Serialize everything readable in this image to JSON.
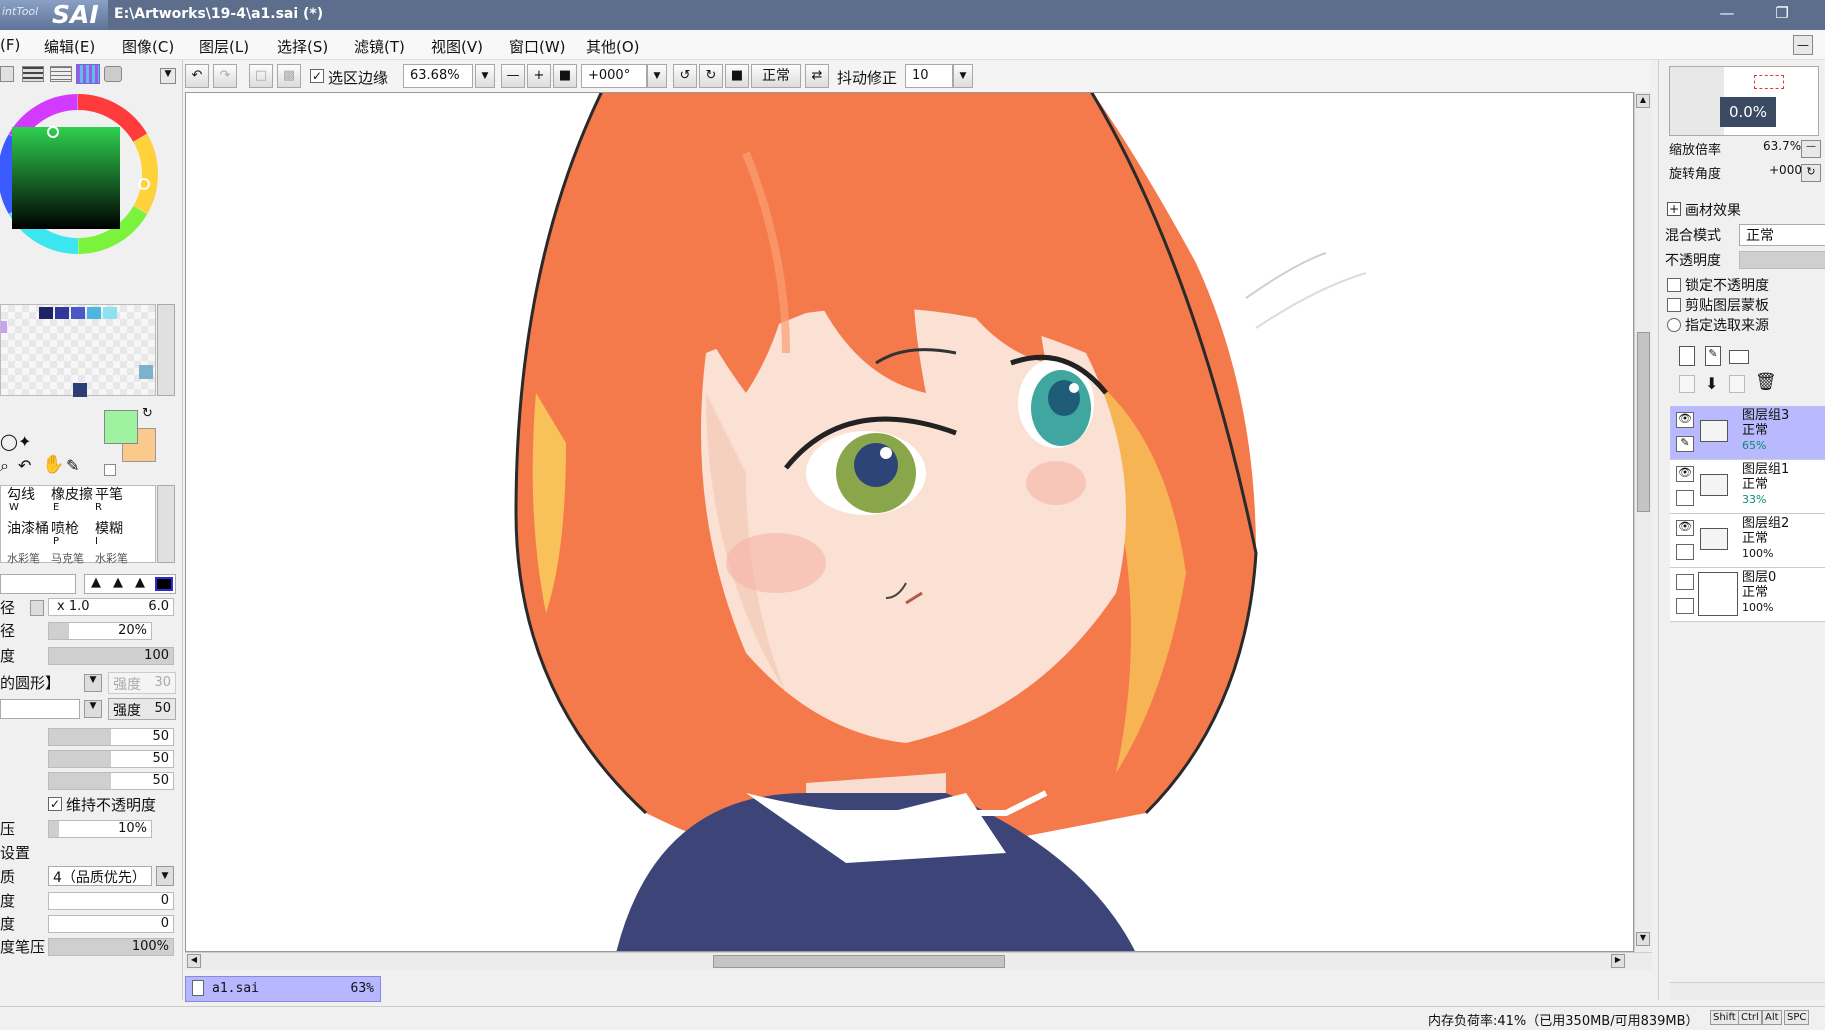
{
  "app": {
    "logo_small": "intTool",
    "logo_big": "SAI",
    "title": "E:\\Artworks\\19-4\\a1.sai (*)"
  },
  "menu": [
    "(F)",
    "编辑(E)",
    "图像(C)",
    "图层(L)",
    "选择(S)",
    "滤镜(T)",
    "视图(V)",
    "窗口(W)",
    "其他(O)"
  ],
  "toolbar": {
    "selection_edge_label": "选区边缘",
    "zoom": "63.68%",
    "rotation": "+000°",
    "blend_mode": "正常",
    "stabilizer_label": "抖动修正",
    "stabilizer_value": "10"
  },
  "left": {
    "tools": [
      {
        "name": "勾线",
        "key": "W"
      },
      {
        "name": "橡皮擦",
        "key": "E"
      },
      {
        "name": "平笔",
        "key": "R"
      },
      {
        "name": "油漆桶",
        "key": ""
      },
      {
        "name": "喷枪",
        "key": "P"
      },
      {
        "name": "模糊",
        "key": "I"
      }
    ],
    "tools_partial": [
      "水彩笔",
      "马克笔",
      "水彩笔"
    ],
    "size_label": "径",
    "size_mult": "x 1.0",
    "size_value": "6.0",
    "min_size_label": "径",
    "min_size_value": "20%",
    "density_label": "度",
    "density_value": "100",
    "shape_value": "的圆形】",
    "shape_strength_label": "强度",
    "shape_strength_value": "30",
    "texture_strength_label": "强度",
    "texture_strength_value": "50",
    "blend_values": [
      "50",
      "50",
      "50"
    ],
    "keep_opacity_label": "维持不透明度",
    "pressure_label": "压",
    "pressure_value": "10%",
    "settings_label": "设置",
    "quality_label": "质",
    "quality_value": "4（品质优先）",
    "edge_label": "度",
    "edge_value": "0",
    "edge2_label": "度",
    "edge2_value": "0",
    "pen_pressure_label": "度笔压",
    "pen_pressure_value": "100%"
  },
  "right": {
    "nav_percent": "0.0%",
    "zoom_label": "缩放倍率",
    "zoom_value": "63.7%",
    "angle_label": "旋转角度",
    "angle_value": "+000",
    "effects_label": "画材效果",
    "blend_label": "混合模式",
    "blend_value": "正常",
    "opacity_label": "不透明度",
    "lock_opacity": "锁定不透明度",
    "clip_mask": "剪贴图层蒙板",
    "selection_source": "指定选取来源",
    "layers": [
      {
        "name": "图层组3",
        "mode": "正常",
        "opacity": "65%"
      },
      {
        "name": "图层组1",
        "mode": "正常",
        "opacity": "33%"
      },
      {
        "name": "图层组2",
        "mode": "正常",
        "opacity": "100%"
      },
      {
        "name": "图层0",
        "mode": "正常",
        "opacity": "100%"
      }
    ]
  },
  "file_tab": {
    "name": "a1.sai",
    "zoom": "63%"
  },
  "status": {
    "memory": "内存负荷率:41%（已用350MB/可用839MB）",
    "keys": [
      "Shift",
      "Ctrl",
      "Alt",
      "SPC"
    ]
  },
  "colors": {
    "title_bar": "#5c6e8c",
    "primary_color": "#9ff2a0",
    "secondary_color": "#fbc98c",
    "selected_layer": "#b9b9ff",
    "hair": "#f47a4c"
  }
}
